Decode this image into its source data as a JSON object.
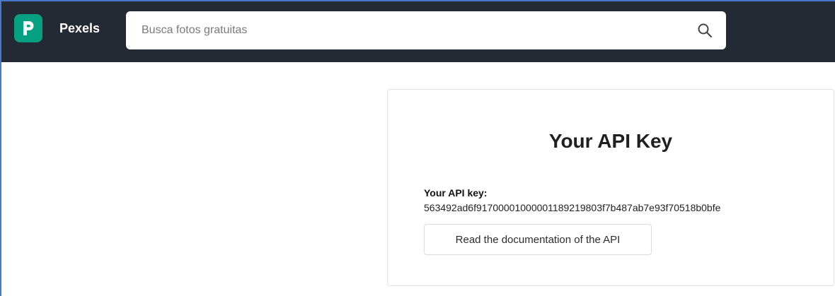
{
  "header": {
    "brand": "Pexels",
    "logo_icon": "pexels-logo-icon",
    "logo_color": "#05a081",
    "bar_color": "#232a34",
    "search": {
      "placeholder": "Busca fotos gratuitas",
      "value": "",
      "icon": "search-icon"
    }
  },
  "api_card": {
    "title": "Your API Key",
    "key_label": "Your API key:",
    "key_value": "563492ad6f91700001000001189219803f7b487ab7e93f70518b0bfe",
    "doc_button_label": "Read the documentation of the API"
  }
}
